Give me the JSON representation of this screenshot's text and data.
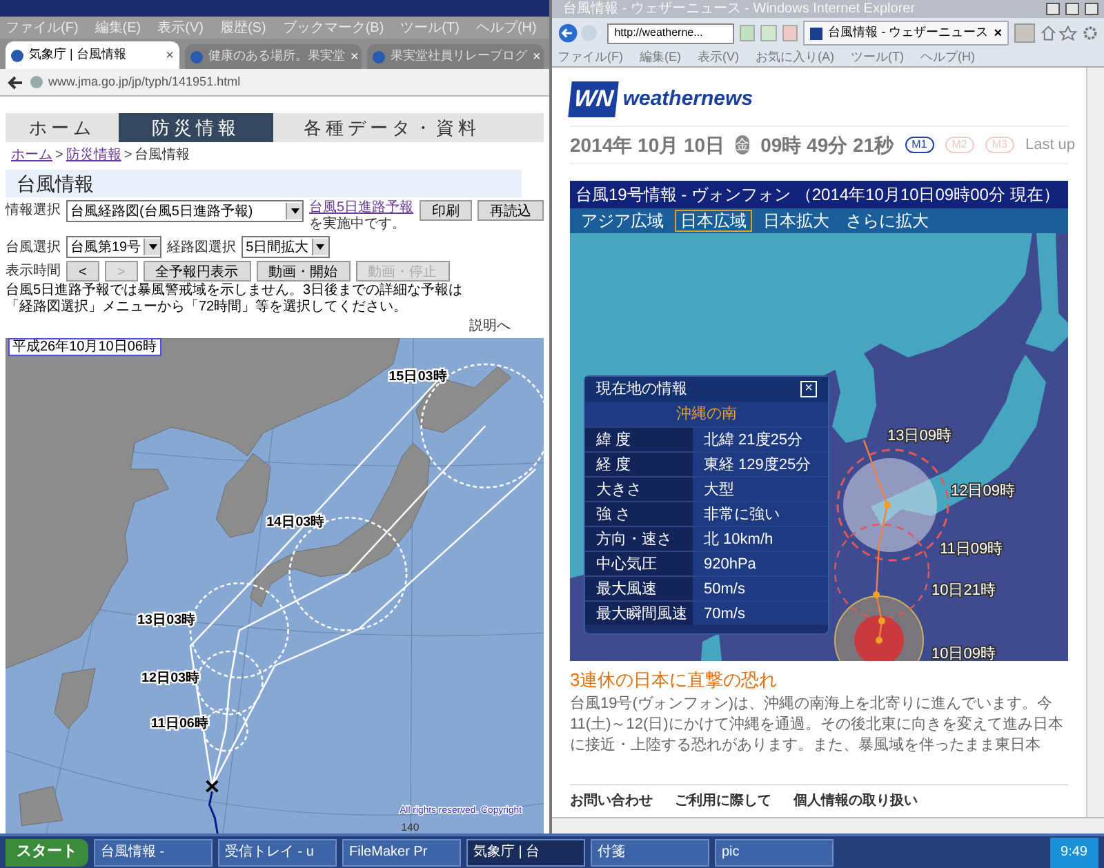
{
  "left_browser": {
    "menu": [
      "ファイル(F)",
      "編集(E)",
      "表示(V)",
      "履歴(S)",
      "ブックマーク(B)",
      "ツール(T)",
      "ヘルプ(H)"
    ],
    "tabs": [
      {
        "label": "気象庁 | 台風情報",
        "close": "×",
        "selected": true
      },
      {
        "label": "健康のある場所。果実堂",
        "close": "×",
        "selected": false
      },
      {
        "label": "果実堂社員リレーブログ",
        "close": "×",
        "selected": false
      }
    ],
    "url": "www.jma.go.jp/jp/typh/141951.html",
    "page": {
      "nav": [
        {
          "label": "ホーム",
          "selected": false
        },
        {
          "label": "防災情報",
          "selected": true
        },
        {
          "label": "各種データ・資料",
          "selected": false
        }
      ],
      "breadcrumb": [
        {
          "kind": "link",
          "label": "ホーム"
        },
        {
          "kind": "sep",
          "label": ">"
        },
        {
          "kind": "link",
          "label": "防災情報"
        },
        {
          "kind": "sep",
          "label": ">"
        },
        {
          "kind": "current",
          "label": "台風情報"
        }
      ],
      "title": "台風情報",
      "info_select": {
        "label": "情報選択",
        "value": "台風経路図(台風5日進路予報)",
        "notice_link": "台風5日進路予報",
        "notice_rest": "を実施中です。"
      },
      "buttons": [
        {
          "label": "印刷",
          "disabled": false
        },
        {
          "label": "再読込",
          "disabled": false
        }
      ],
      "typhoon_select": {
        "label": "台風選択",
        "value": "台風第19号"
      },
      "route_select": {
        "label": "経路図選択",
        "value": "5日間拡大"
      },
      "time_label": "表示時間",
      "time_buttons": [
        {
          "label": "<",
          "disabled": false
        },
        {
          "label": ">",
          "disabled": true
        },
        {
          "label": "全予報円表示",
          "disabled": false
        },
        {
          "label": "動画・開始",
          "disabled": false
        },
        {
          "label": "動画・停止",
          "disabled": true
        }
      ],
      "note": "台風5日進路予報では暴風警戒域を示しません。3日後までの詳細な予報は「経路図選択」メニューから「72時間」等を選択してください。",
      "help_link": "説明へ",
      "map": {
        "timestamp": "平成26年10月10日06時",
        "labels": [
          "15日03時",
          "14日03時",
          "13日03時",
          "12日03時",
          "11日06時"
        ],
        "copyright": "All rights reserved. Copyright",
        "axis_label": "140"
      }
    }
  },
  "right_browser": {
    "title": "台風情報 - ウェザーニュース - Windows Internet Explorer",
    "address": "http://weatherne...",
    "tab": "台風情報 - ウェザーニュース",
    "tab_close": "×",
    "menu": [
      "ファイル(F)",
      "編集(E)",
      "表示(V)",
      "お気に入り(A)",
      "ツール(T)",
      "ヘルプ(H)"
    ],
    "page": {
      "logo_mark": "WN",
      "logo_text": "weathernews",
      "date": "2014年 10月 10日",
      "weekday": "金",
      "time": "09時 49分 21秒",
      "modes": [
        {
          "label": "M1",
          "selected": true
        },
        {
          "label": "M2",
          "selected": false
        },
        {
          "label": "M3",
          "selected": false
        }
      ],
      "last_update": "Last up",
      "typhoon": {
        "header": "台風19号情報 - ヴォンフォン （2014年10月10日09時00分 現在）",
        "views": [
          {
            "label": "アジア広域",
            "selected": false
          },
          {
            "label": "日本広域",
            "selected": true
          },
          {
            "label": "日本拡大",
            "selected": false
          },
          {
            "label": "さらに拡大",
            "selected": false
          }
        ],
        "map_labels": [
          "13日09時",
          "12日09時",
          "11日09時",
          "10日21時",
          "10日09時"
        ],
        "panel": {
          "title": "現在地の情報",
          "close": "×",
          "location": "沖縄の南",
          "rows": [
            {
              "label": "緯 度",
              "value": "北緯 21度25分"
            },
            {
              "label": "経 度",
              "value": "東経 129度25分"
            },
            {
              "label": "大きさ",
              "value": "大型"
            },
            {
              "label": "強 さ",
              "value": "非常に強い"
            },
            {
              "label": "方向・速さ",
              "value": "北 10km/h"
            },
            {
              "label": "中心気圧",
              "value": "920hPa"
            },
            {
              "label": "最大風速",
              "value": "50m/s"
            },
            {
              "label": "最大瞬間風速",
              "value": "70m/s"
            }
          ]
        }
      },
      "headline": "3連休の日本に直撃の恐れ",
      "body": "台風19号(ヴォンフォン)は、沖縄の南海上を北寄りに進んでいます。今11(土)～12(日)にかけて沖縄を通過。その後北東に向きを変えて進み日本に接近・上陸する恐れがあります。また、暴風域を伴ったまま東日本",
      "footer_links": [
        "お問い合わせ",
        "ご利用に際して",
        "個人情報の取り扱い"
      ]
    }
  },
  "taskbar": {
    "start": "スタート",
    "items": [
      {
        "label": "台風情報 -",
        "selected": false
      },
      {
        "label": "受信トレイ - u",
        "selected": false
      },
      {
        "label": "FileMaker Pr",
        "selected": false
      },
      {
        "label": "気象庁 | 台",
        "selected": true
      },
      {
        "label": "付箋",
        "selected": false
      },
      {
        "label": "pic",
        "selected": false
      }
    ],
    "clock": "9:49"
  }
}
